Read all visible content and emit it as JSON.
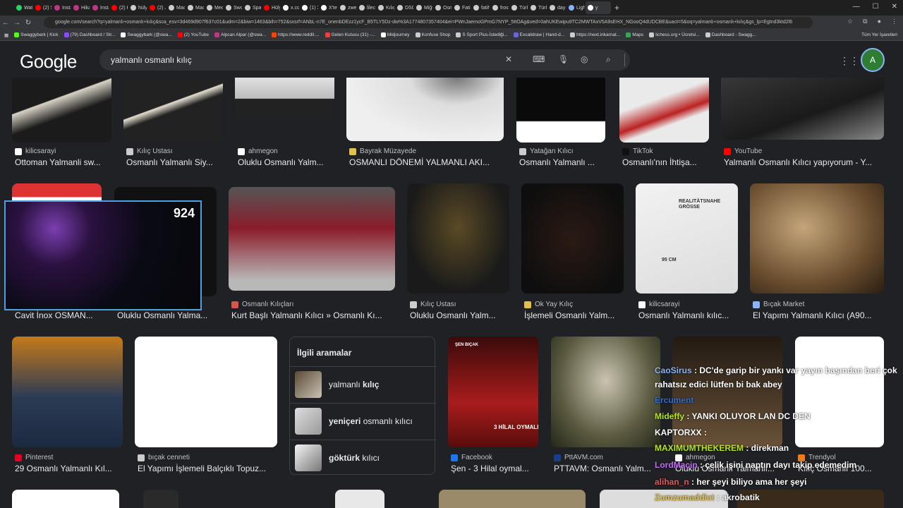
{
  "browser": {
    "tabs": [
      {
        "label": "Wats",
        "color": "#25d366"
      },
      {
        "label": "(2) S",
        "color": "#ff0000"
      },
      {
        "label": "Insta",
        "color": "#c13584"
      },
      {
        "label": "Hika",
        "color": "#c13584"
      },
      {
        "label": "Insta",
        "color": "#c13584"
      },
      {
        "label": "(2) H",
        "color": "#ff0000"
      },
      {
        "label": "hülya",
        "color": "#cccccc"
      },
      {
        "label": "(2) Ji",
        "color": "#ff0000"
      },
      {
        "label": "Macr",
        "color": "#cccccc"
      },
      {
        "label": "Macr",
        "color": "#cccccc"
      },
      {
        "label": "Med",
        "color": "#cccccc"
      },
      {
        "label": "Swo",
        "color": "#cccccc"
      },
      {
        "label": "Spati",
        "color": "#cccccc"
      },
      {
        "label": "Hülya",
        "color": "#ff0000"
      },
      {
        "label": "x.con",
        "color": "#ffffff"
      },
      {
        "label": "(1) X",
        "color": "#ffffff"
      },
      {
        "label": "X'te",
        "color": "#ffffff"
      },
      {
        "label": "zweil",
        "color": "#cccccc"
      },
      {
        "label": "lilecu",
        "color": "#cccccc"
      },
      {
        "label": "Kılıç",
        "color": "#cccccc"
      },
      {
        "label": "DSCI",
        "color": "#cccccc"
      },
      {
        "label": "Miğf",
        "color": "#cccccc"
      },
      {
        "label": "Osm",
        "color": "#cccccc"
      },
      {
        "label": "Fatih",
        "color": "#cccccc"
      },
      {
        "label": "fatih",
        "color": "#cccccc"
      },
      {
        "label": "frost",
        "color": "#cccccc"
      },
      {
        "label": "Türk",
        "color": "#cccccc"
      },
      {
        "label": "Türk",
        "color": "#cccccc"
      },
      {
        "label": "dayı",
        "color": "#cccccc"
      },
      {
        "label": "Ligh",
        "color": "#8ab4f8"
      },
      {
        "label": "y",
        "color": "#ffffff",
        "active": true
      }
    ],
    "url": "google.com/search?q=yalmanlı+osmanlı+kılıç&sca_esv=3d469d907f637c01&udm=2&biw=1463&bih=752&sxsrf=ANbL-n7E_onenbDEzz1ycF_B5TLY5Dz-dw%3A1774807357404&ei=PWnJaemoGPmG7NYP_5ttOAg&ved=0ahUKEwipu9TC2MWTAxV5A9sEHX_NGooQ4dUDCBE&uact=5&oq=yalmanlı+osmanlı+kılıç&gs_lp=Egtnd3ktd2l6",
    "bookmarks": [
      {
        "label": "Swaggybark | Kick",
        "color": "#53fc18"
      },
      {
        "label": "(79) Dashboard / Str...",
        "color": "#9146ff"
      },
      {
        "label": "Swaggybark (@swa...",
        "color": "#ffffff"
      },
      {
        "label": "(2) YouTube",
        "color": "#ff0000"
      },
      {
        "label": "Alpcan Alpar (@swa...",
        "color": "#c13584"
      },
      {
        "label": "https://www.reddit....",
        "color": "#ff4500"
      },
      {
        "label": "Gelen Kutusu (31) -...",
        "color": "#ea4335"
      },
      {
        "label": "Midjourney",
        "color": "#ffffff"
      },
      {
        "label": "Konfuse Shop",
        "color": "#cccccc"
      },
      {
        "label": "S Sport Plus-İstediği...",
        "color": "#cccccc"
      },
      {
        "label": "Excalidraw | Hand-d...",
        "color": "#6965db"
      },
      {
        "label": "https://next.inkarnat...",
        "color": "#cccccc"
      },
      {
        "label": "Maps",
        "color": "#34a853"
      },
      {
        "label": "lichess.org • Ücretsi...",
        "color": "#cccccc"
      },
      {
        "label": "Dashboard - Swagg...",
        "color": "#cccccc"
      }
    ],
    "bookmarks_right": "Tüm Yer İşaretleri"
  },
  "google": {
    "logo": "Google",
    "query": "yalmanlı osmanlı kılıç",
    "avatar": "A"
  },
  "results": [
    {
      "source": "kilicsarayi",
      "title": "Ottoman Yalmanli sw...",
      "fav": "#ffffff"
    },
    {
      "source": "Kılıç Ustası",
      "title": "Osmanlı Yalmanlı Siy...",
      "fav": "#cccccc"
    },
    {
      "source": "ahmegon",
      "title": "Oluklu Osmanlı Yalm...",
      "fav": "#ffffff"
    },
    {
      "source": "Bayrak Müzayede",
      "title": "OSMANLI DÖNEMİ YALMANLI AKI...",
      "fav": "#e2c04a"
    },
    {
      "source": "Yatağan Kılıcı",
      "title": "Osmanlı Yalmanlı ...",
      "fav": "#cccccc"
    },
    {
      "source": "TikTok",
      "title": "Osmanlı'nın İhtişa...",
      "fav": "#111111"
    },
    {
      "source": "YouTube",
      "title": "Yalmanlı Osmanlı Kılıcı yapıyorum - Y...",
      "fav": "#ff0000"
    },
    {
      "source": "",
      "title": "Cavit İnox OSMAN...",
      "fav": "#ffffff"
    },
    {
      "source": "",
      "title": "Oluklu Osmanlı Yalma...",
      "fav": "#ffffff"
    },
    {
      "source": "Osmanlı Kılıçları",
      "title": "Kurt Başlı Yalmanlı Kılıcı » Osmanlı Kı...",
      "fav": "#d9534f"
    },
    {
      "source": "Kılıç Ustası",
      "title": "Oluklu Osmanlı Yalm...",
      "fav": "#cccccc"
    },
    {
      "source": "Ok Yay Kılıç",
      "title": "İşlemeli Osmanlı Yalm...",
      "fav": "#e2c04a"
    },
    {
      "source": "kilicsarayi",
      "title": "Osmanlı Yalmanlı kılıc...",
      "fav": "#ffffff"
    },
    {
      "source": "Bıçak Market",
      "title": "El Yapımı Yalmanlı Kılıcı (A90...",
      "fav": "#8ab4f8"
    },
    {
      "source": "Pinterest",
      "title": "29 Osmanlı Yalmanlı Kıl...",
      "fav": "#e60023"
    },
    {
      "source": "bıçak cenneti",
      "title": "El Yapımı İşlemeli Balçıklı Topuz...",
      "fav": "#cccccc"
    },
    {
      "source": "Facebook",
      "title": "Şen - 3 Hilal oymal...",
      "fav": "#1877f2"
    },
    {
      "source": "PttAVM.com",
      "title": "PTTAVM: Osmanlı Yalm...",
      "fav": "#1a3f8a"
    },
    {
      "source": "ahmegon",
      "title": "Oluklu Osmanlı Yalmanlı...",
      "fav": "#ffffff"
    },
    {
      "source": "Trendyol",
      "title": "Kılıç Osmanlı 100...",
      "fav": "#f27a1a"
    }
  ],
  "image_texts": {
    "realitatsnahe": "REALITÄTSNAHE GRÖSSE",
    "size": "95 CM",
    "sen": "ŞEN BIÇAK",
    "hilal": "3 HİLAL OYMALI"
  },
  "related": {
    "heading": "İlgili aramalar",
    "items": [
      {
        "prefix": "yalmanlı ",
        "bold": "kılıç"
      },
      {
        "prefix": "",
        "bold": "yeniçeri",
        "suffix": " osmanlı kılıcı"
      },
      {
        "prefix": "",
        "bold": "göktürk",
        "suffix": " kılıcı"
      }
    ]
  },
  "overlay": {
    "viewer_count": "924",
    "chat": [
      {
        "user": "CaoSirus",
        "user_color": "#8ab4f8",
        "msg": ": DC'de garip bir yankı var yayın başından beri çok"
      },
      {
        "user": "",
        "user_color": "#ffffff",
        "msg": "rahatsız edici lütfen bi bak abey"
      },
      {
        "user": "Ercument",
        "user_color": "#2f6fd6",
        "msg": ""
      },
      {
        "user": "Mideffy",
        "user_color": "#b5e61d",
        "msg": ": YANKI OLUYOR LAN DC DEN"
      },
      {
        "user": "KAPTORXX",
        "user_color": "#ffffff",
        "msg": ":"
      },
      {
        "user": "MAXIMUMTHEKEREM",
        "user_color": "#b5e61d",
        "msg": ": direkman"
      },
      {
        "user": "LordMacin",
        "user_color": "#c46bff",
        "msg": ": çelik işini naptın dayı takip edemedim"
      },
      {
        "user": "alihan_n",
        "user_color": "#e05a5a",
        "msg": ": her şeyi biliyo ama her şeyi"
      },
      {
        "user": "Zumzumaddict",
        "user_color": "#e2c04a",
        "msg": ": akrobatik"
      }
    ]
  }
}
